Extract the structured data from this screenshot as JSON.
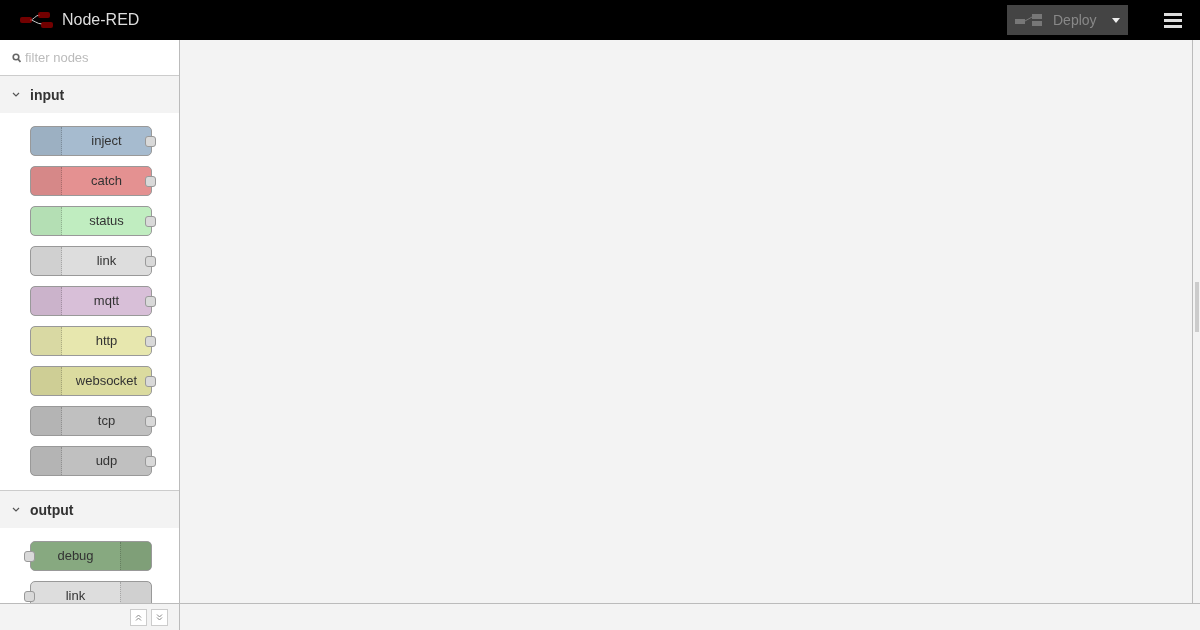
{
  "header": {
    "title": "Node-RED",
    "deploy": {
      "label": "Deploy",
      "disabled": true
    }
  },
  "palette": {
    "search": {
      "placeholder": "filter nodes"
    },
    "categories": [
      {
        "label": "input",
        "expanded": true,
        "nodes": [
          {
            "label": "inject",
            "kind": "input",
            "color": "#a6bbcf"
          },
          {
            "label": "catch",
            "kind": "input",
            "color": "#e49191"
          },
          {
            "label": "status",
            "kind": "input",
            "color": "#c0edc0"
          },
          {
            "label": "link",
            "kind": "input",
            "color": "#dddddd"
          },
          {
            "label": "mqtt",
            "kind": "input",
            "color": "#d8bfd8"
          },
          {
            "label": "http",
            "kind": "input",
            "color": "#e7e7ae"
          },
          {
            "label": "websocket",
            "kind": "input",
            "color": "#dbdb9f"
          },
          {
            "label": "tcp",
            "kind": "input",
            "color": "#c0c0c0"
          },
          {
            "label": "udp",
            "kind": "input",
            "color": "#c0c0c0"
          }
        ]
      },
      {
        "label": "output",
        "expanded": true,
        "nodes": [
          {
            "label": "debug",
            "kind": "output",
            "color": "#87a980"
          },
          {
            "label": "link",
            "kind": "output",
            "color": "#dddddd"
          }
        ]
      }
    ]
  }
}
